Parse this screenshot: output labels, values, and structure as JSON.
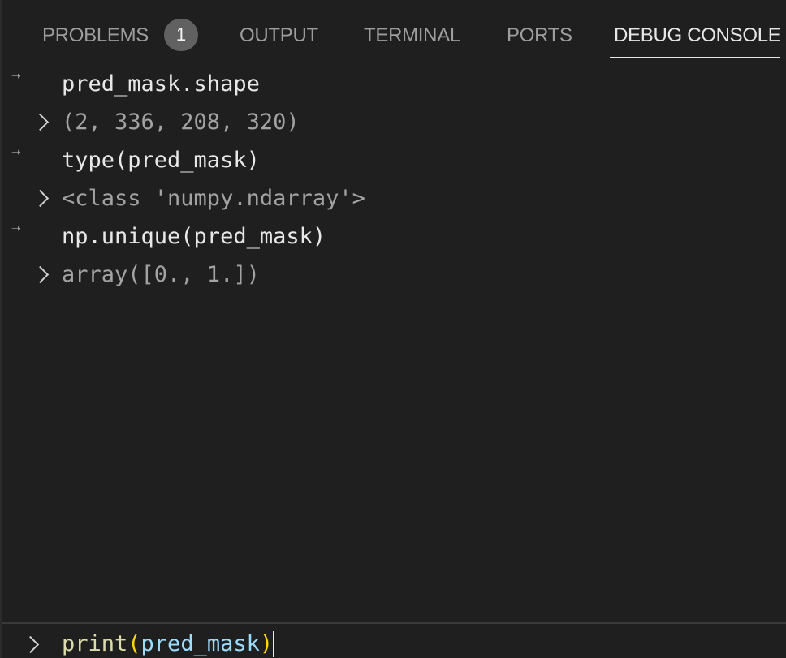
{
  "tabs": [
    {
      "label": "PROBLEMS",
      "badge": "1"
    },
    {
      "label": "OUTPUT"
    },
    {
      "label": "TERMINAL"
    },
    {
      "label": "PORTS"
    },
    {
      "label": "DEBUG CONSOLE",
      "active": true
    }
  ],
  "console": [
    {
      "kind": "input",
      "text": "pred_mask.shape"
    },
    {
      "kind": "output",
      "text": "(2, 336, 208, 320)"
    },
    {
      "kind": "input",
      "text": "type(pred_mask)"
    },
    {
      "kind": "output",
      "text": "<class 'numpy.ndarray'>"
    },
    {
      "kind": "input",
      "text": "np.unique(pred_mask)"
    },
    {
      "kind": "output",
      "text": "array([0., 1.])"
    }
  ],
  "repl": {
    "fn": "print",
    "open_paren": "(",
    "arg": "pred_mask",
    "close_paren": ")"
  },
  "icons": {
    "input_marker": "arrow-right-icon",
    "output_marker": "chevron-right-icon",
    "prompt_marker": "chevron-right-icon"
  },
  "colors": {
    "background": "#1f1f1f",
    "active_tab": "#e7e7e7",
    "inactive_tab": "#9d9d9d",
    "badge": "#616161"
  }
}
